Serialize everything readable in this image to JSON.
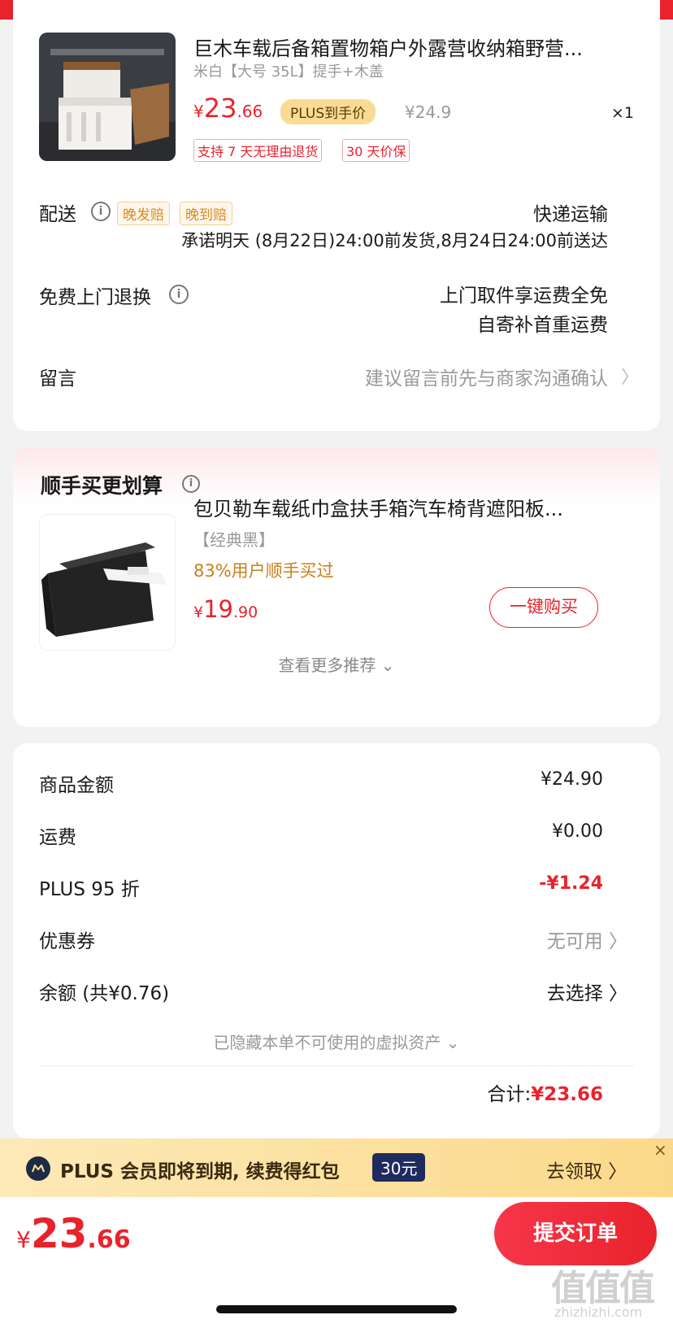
{
  "product": {
    "title": "巨木车载后备箱置物箱户外露营收纳箱野营...",
    "spec": "米白【大号 35L】提手+木盖",
    "price_symbol": "¥",
    "price_int": "23",
    "price_dec": ".66",
    "plus_badge": "PLUS到手价",
    "original_price": "¥24.9",
    "quantity": "×1",
    "tags": [
      "支持 7 天无理由退货",
      "30 天价保"
    ]
  },
  "delivery": {
    "label": "配送",
    "badges": [
      "晚发赔",
      "晚到赔"
    ],
    "method": "快递运输",
    "promise": "承诺明天 (8月22日)24:00前发货,8月24日24:00前送达"
  },
  "returns": {
    "label": "免费上门退换",
    "line1": "上门取件享运费全免",
    "line2": "自寄补首重运费"
  },
  "message": {
    "label": "留言",
    "placeholder": "建议留言前先与商家沟通确认",
    "chevron": "〉"
  },
  "addon": {
    "heading": "顺手买更划算",
    "title": "包贝勒车载纸巾盒扶手箱汽车椅背遮阳板...",
    "spec": "【经典黑】",
    "social": "83%用户顺手买过",
    "price_symbol": "¥",
    "price_int": "19",
    "price_dec": ".90",
    "buy_button": "一键购买",
    "more": "查看更多推荐 ⌄"
  },
  "summary": {
    "rows": [
      {
        "label": "商品金额",
        "value": "¥24.90"
      },
      {
        "label": "运费",
        "value": "¥0.00"
      },
      {
        "label": "PLUS 95 折",
        "value": "-¥1.24"
      },
      {
        "label": "优惠券",
        "value": "无可用 〉"
      },
      {
        "label": "余额 (共¥0.76)",
        "value": "去选择 〉"
      }
    ],
    "hidden_assets": "已隐藏本单不可使用的虚拟资产 ⌄",
    "total_label": "合计:",
    "total_value": "¥23.66"
  },
  "banner": {
    "text": "PLUS 会员即将到期, 续费得红包",
    "badge": "30元",
    "action": "去领取 〉",
    "close": "×"
  },
  "footer": {
    "price_symbol": "¥",
    "price_int": "23",
    "price_dec": ".66",
    "submit": "提交订单"
  },
  "watermark": {
    "big": "值值值",
    "small": "zhizhizhi.com"
  },
  "colors": {
    "accent_red": "#e8232c",
    "plus_gold": "#f8dc93",
    "banner_bg": "#fbd98a"
  }
}
